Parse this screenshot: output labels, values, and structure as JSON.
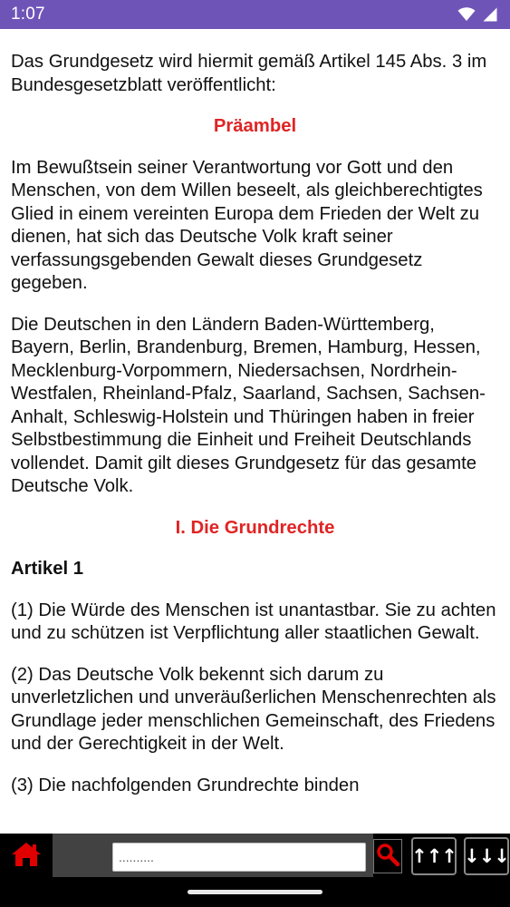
{
  "status_bar": {
    "time": "1:07",
    "background": "#6f54b8",
    "icons": [
      "wifi-icon",
      "cellular-signal-icon"
    ]
  },
  "content": {
    "intro": "Das Grundgesetz wird hiermit gemäß Artikel 145 Abs. 3 im Bundesgesetzblatt veröffentlicht:",
    "preamble_heading": "Präambel",
    "preamble_paragraph_1": "Im Bewußtsein seiner Verantwortung vor Gott und den Menschen, von dem Willen beseelt, als gleichberechtigtes Glied in einem vereinten Europa dem Frieden der Welt zu dienen, hat sich das Deutsche Volk kraft seiner verfassungsgebenden Gewalt dieses Grundgesetz gegeben.",
    "preamble_paragraph_2": "Die Deutschen in den Ländern Baden-Württemberg, Bayern, Berlin, Brandenburg, Bremen, Hamburg, Hessen, Mecklenburg-Vorpommern, Niedersachsen, Nordrhein-Westfalen, Rheinland-Pfalz, Saarland, Sachsen, Sachsen-Anhalt, Schleswig-Holstein und Thüringen haben in freier Selbstbestimmung die Einheit und Freiheit Deutschlands vollendet. Damit gilt dieses Grundgesetz für das gesamte Deutsche Volk.",
    "section_heading": "I. Die Grundrechte",
    "article_title": "Artikel 1",
    "article_paragraph_1": "(1) Die Würde des Menschen ist unantastbar. Sie zu achten und zu schützen ist Verpflichtung aller staatlichen Gewalt.",
    "article_paragraph_2": "(2) Das Deutsche Volk bekennt sich darum zu unverletzlichen und unveräußerlichen Menschenrechten als Grundlage jeder menschlichen Gemeinschaft, des Friedens und der Gerechtigkeit in der Welt.",
    "article_paragraph_3": "(3) Die nachfolgenden Grundrechte binden",
    "heading_color": "#e02424"
  },
  "bottom_bar": {
    "search_placeholder": "..........",
    "search_value": "",
    "scroll_up_label": "↑↑↑",
    "scroll_down_label": "↓↓↓",
    "accent_color": "#e00000"
  }
}
